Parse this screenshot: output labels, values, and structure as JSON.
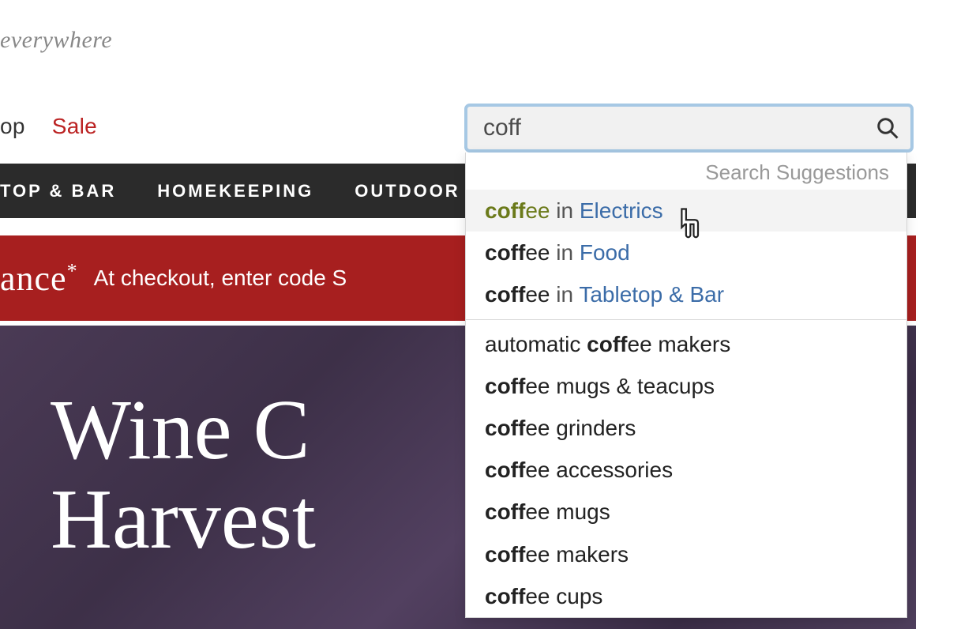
{
  "logo_tagline": "everywhere",
  "top_nav": {
    "shop": "op",
    "sale": "Sale"
  },
  "cat_bar": {
    "tabletop": "TOP & BAR",
    "homekeeping": "HOMEKEEPING",
    "outdoor": "OUTDOOR"
  },
  "promo": {
    "headline": "ance",
    "asterisk": "*",
    "sub": "At checkout, enter code S"
  },
  "hero": {
    "line1": "Wine C",
    "line2": "Harvest"
  },
  "search": {
    "value": "coff",
    "header": "Search Suggestions"
  },
  "suggestions": {
    "cat": [
      {
        "pre": "coff",
        "rest": "ee",
        "in": " in ",
        "category": "Electrics"
      },
      {
        "pre": "coff",
        "rest": "ee",
        "in": " in ",
        "category": "Food"
      },
      {
        "pre": "coff",
        "rest": "ee",
        "in": " in ",
        "category": "Tabletop & Bar"
      }
    ],
    "plain": [
      {
        "lead": "automatic ",
        "pre": "coff",
        "rest": "ee",
        "tail": " makers"
      },
      {
        "lead": "",
        "pre": "coff",
        "rest": "ee",
        "tail": " mugs & teacups"
      },
      {
        "lead": "",
        "pre": "coff",
        "rest": "ee",
        "tail": " grinders"
      },
      {
        "lead": "",
        "pre": "coff",
        "rest": "ee",
        "tail": " accessories"
      },
      {
        "lead": "",
        "pre": "coff",
        "rest": "ee",
        "tail": " mugs"
      },
      {
        "lead": "",
        "pre": "coff",
        "rest": "ee",
        "tail": " makers"
      },
      {
        "lead": "",
        "pre": "coff",
        "rest": "ee",
        "tail": " cups"
      }
    ]
  }
}
